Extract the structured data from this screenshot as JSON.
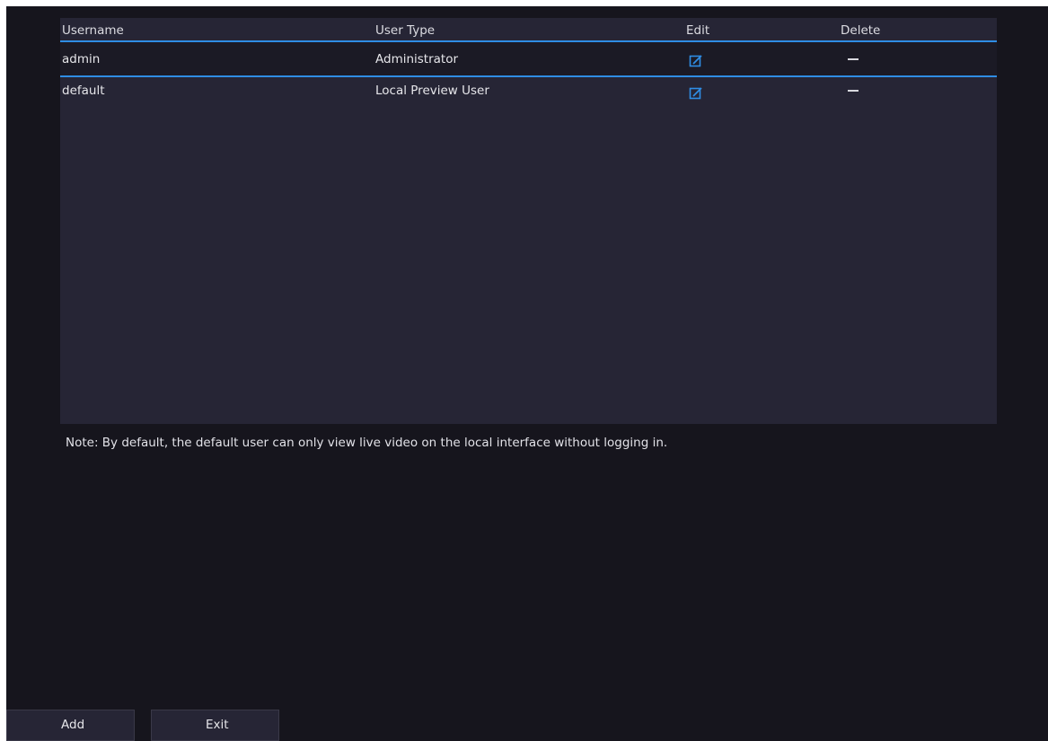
{
  "table": {
    "headers": {
      "username": "Username",
      "user_type": "User Type",
      "edit": "Edit",
      "delete": "Delete"
    },
    "rows": [
      {
        "username": "admin",
        "user_type": "Administrator",
        "edit_icon": "edit-icon",
        "delete_icon": "delete-disabled-dash"
      },
      {
        "username": "default",
        "user_type": "Local Preview User",
        "edit_icon": "edit-icon",
        "delete_icon": "delete-disabled-dash"
      }
    ]
  },
  "note": "Note: By default, the default user can only view live video on the local interface without logging in.",
  "buttons": {
    "add": "Add",
    "exit": "Exit"
  },
  "colors": {
    "background": "#16151d",
    "table_background": "#262535",
    "selected_row": "#1b1a25",
    "accent": "#2f8de4"
  }
}
